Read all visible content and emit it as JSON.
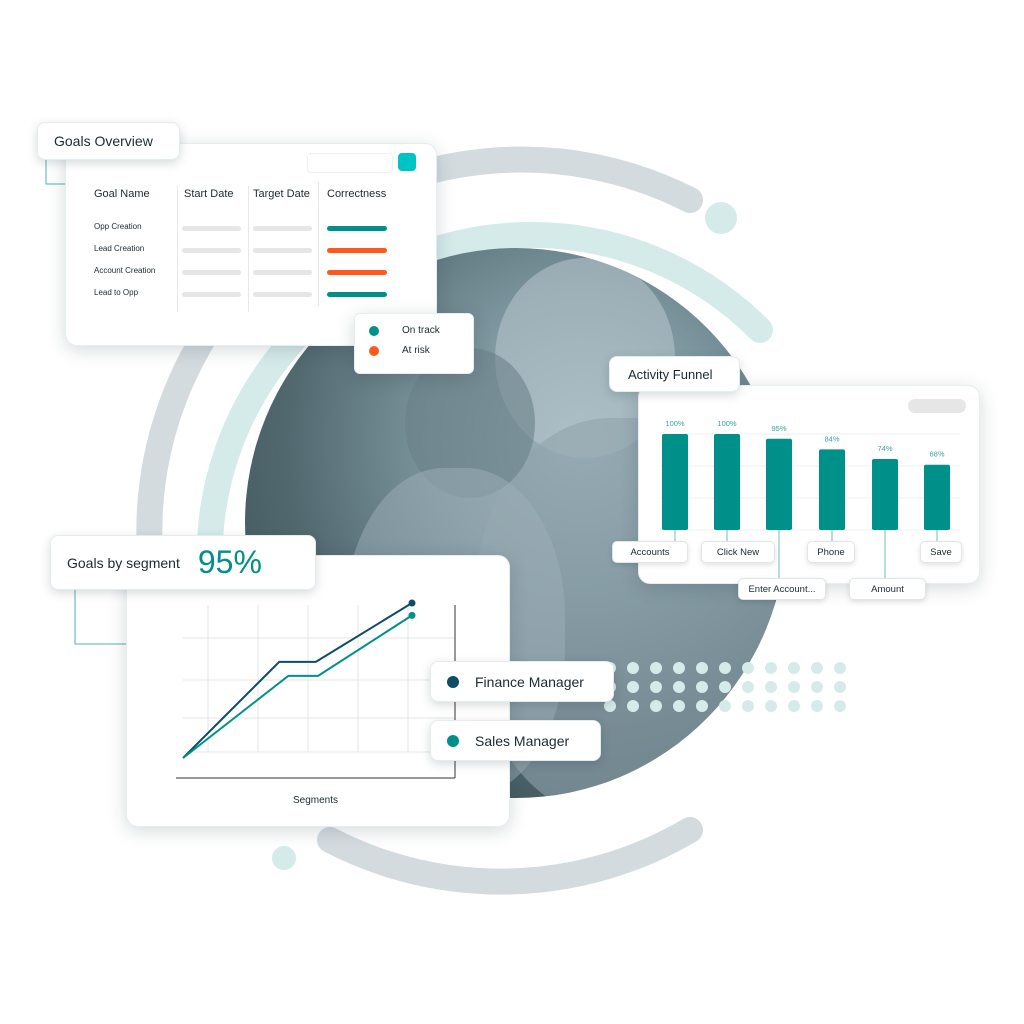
{
  "colors": {
    "teal": "#00908a",
    "orange": "#fe5a1d",
    "dark_teal": "#0f4d63",
    "light_teal": "#d5ebea",
    "gray_arc": "#d3dbdf",
    "accent_button": "#00c4c4"
  },
  "goals_overview": {
    "title": "Goals Overview",
    "columns": [
      "Goal Name",
      "Start Date",
      "Target Date",
      "Correctness"
    ],
    "rows": [
      {
        "name": "Opp Creation",
        "status": "on_track"
      },
      {
        "name": "Lead Creation",
        "status": "at_risk"
      },
      {
        "name": "Account Creation",
        "status": "at_risk"
      },
      {
        "name": "Lead to Opp",
        "status": "on_track"
      }
    ],
    "legend": [
      {
        "label": "On track",
        "color": "#00908a"
      },
      {
        "label": "At risk",
        "color": "#fe5a1d"
      }
    ]
  },
  "chart_data": [
    {
      "type": "bar",
      "title": "Activity Funnel",
      "categories": [
        "Accounts",
        "Click New",
        "Enter Account...",
        "Phone",
        "Amount",
        "Save"
      ],
      "values": [
        100,
        100,
        95,
        84,
        74,
        68
      ],
      "data_labels": [
        "100%",
        "100%",
        "95%",
        "84%",
        "74%",
        "68%"
      ],
      "ylim": [
        0,
        100
      ],
      "grid": true,
      "color": "#00908a"
    },
    {
      "type": "line",
      "title": "Goals by segment",
      "headline_value": "95%",
      "xlabel": "Segments",
      "grid": true,
      "series": [
        {
          "name": "Finance Manager",
          "color": "#0f4d63",
          "values": [
            [
              0,
              0
            ],
            [
              42,
              62
            ],
            [
              58,
              62
            ],
            [
              100,
              100
            ]
          ]
        },
        {
          "name": "Sales Manager",
          "color": "#00908a",
          "values": [
            [
              0,
              0
            ],
            [
              46,
              53
            ],
            [
              59,
              53
            ],
            [
              100,
              92
            ]
          ]
        }
      ]
    }
  ]
}
